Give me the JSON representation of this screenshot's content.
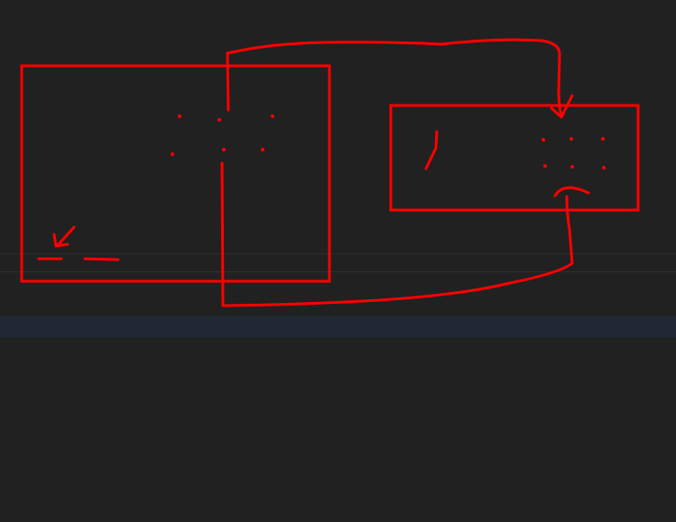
{
  "canvas": {
    "background": "#212121",
    "band_color": "#1f2833",
    "line_color": "#2f2f2f"
  },
  "drawing": {
    "stroke_color": "#ff0000",
    "shapes": [
      "left-rectangle",
      "right-rectangle",
      "top-connector",
      "bottom-connector",
      "dots",
      "arrow"
    ]
  }
}
